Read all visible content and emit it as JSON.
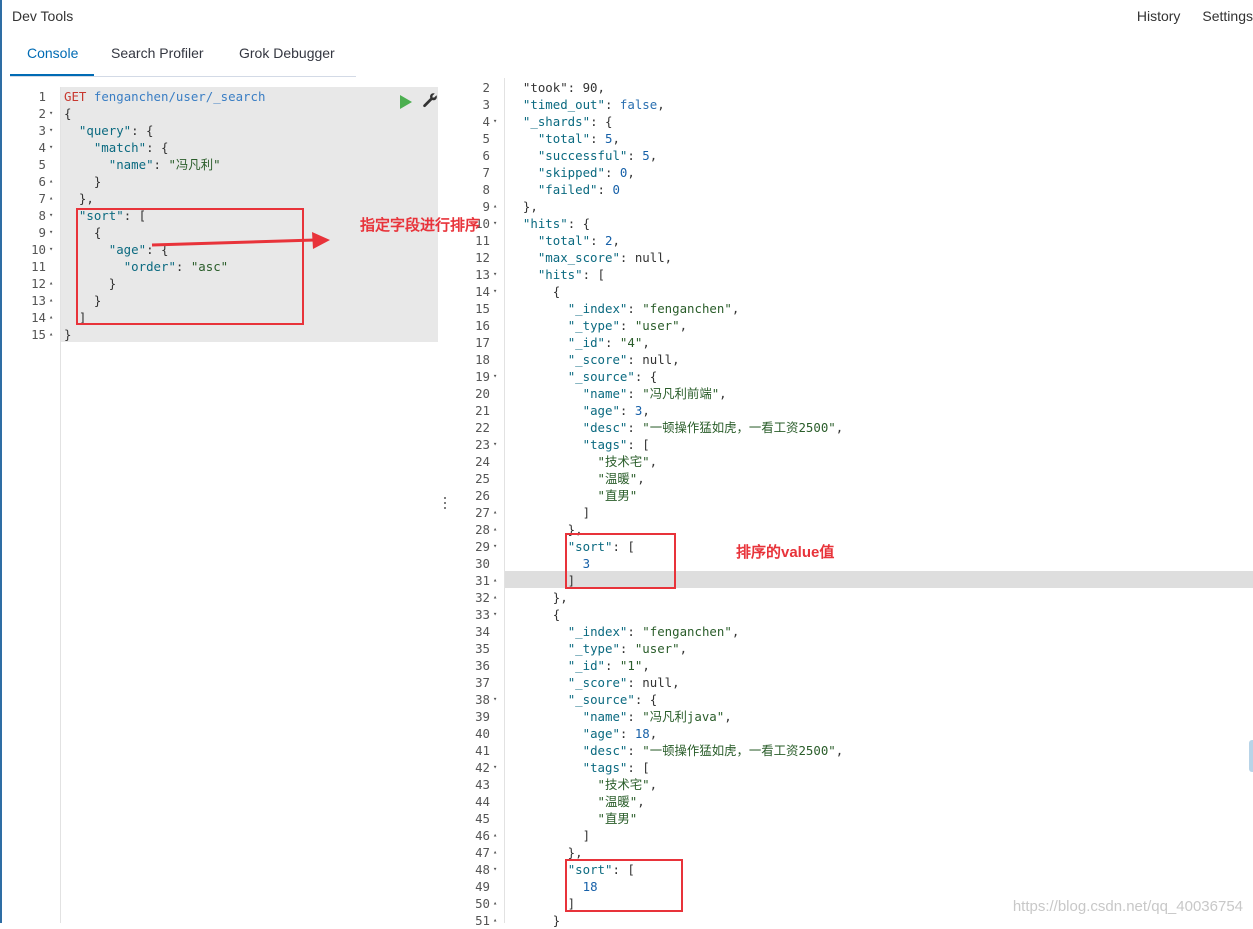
{
  "app": {
    "title": "Dev Tools",
    "history_label": "History",
    "settings_label": "Settings"
  },
  "tabs": [
    {
      "label": "Console",
      "active": true
    },
    {
      "label": "Search Profiler",
      "active": false
    },
    {
      "label": "Grok Debugger",
      "active": false
    }
  ],
  "request_editor": {
    "lines": [
      {
        "n": "1",
        "fold": "",
        "tokens": [
          {
            "t": "GET",
            "c": "get"
          },
          {
            "t": " ",
            "c": ""
          },
          {
            "t": "fenganchen/user/_search",
            "c": "url"
          }
        ]
      },
      {
        "n": "2",
        "fold": "▾",
        "tokens": [
          {
            "t": "{",
            "c": ""
          }
        ]
      },
      {
        "n": "3",
        "fold": "▾",
        "tokens": [
          {
            "t": "  ",
            "c": ""
          },
          {
            "t": "\"query\"",
            "c": "k"
          },
          {
            "t": ": {",
            "c": ""
          }
        ]
      },
      {
        "n": "4",
        "fold": "▾",
        "tokens": [
          {
            "t": "    ",
            "c": ""
          },
          {
            "t": "\"match\"",
            "c": "k"
          },
          {
            "t": ": {",
            "c": ""
          }
        ]
      },
      {
        "n": "5",
        "fold": "",
        "tokens": [
          {
            "t": "      ",
            "c": ""
          },
          {
            "t": "\"name\"",
            "c": "k"
          },
          {
            "t": ": ",
            "c": ""
          },
          {
            "t": "\"冯凡利\"",
            "c": "s"
          }
        ]
      },
      {
        "n": "6",
        "fold": "▴",
        "tokens": [
          {
            "t": "    }",
            "c": ""
          }
        ]
      },
      {
        "n": "7",
        "fold": "▴",
        "tokens": [
          {
            "t": "  },",
            "c": ""
          }
        ]
      },
      {
        "n": "8",
        "fold": "▾",
        "tokens": [
          {
            "t": "  ",
            "c": ""
          },
          {
            "t": "\"sort\"",
            "c": "k"
          },
          {
            "t": ": [",
            "c": ""
          }
        ]
      },
      {
        "n": "9",
        "fold": "▾",
        "tokens": [
          {
            "t": "    {",
            "c": ""
          }
        ]
      },
      {
        "n": "10",
        "fold": "▾",
        "tokens": [
          {
            "t": "      ",
            "c": ""
          },
          {
            "t": "\"age\"",
            "c": "k"
          },
          {
            "t": ": {",
            "c": ""
          }
        ]
      },
      {
        "n": "11",
        "fold": "",
        "tokens": [
          {
            "t": "        ",
            "c": ""
          },
          {
            "t": "\"order\"",
            "c": "k"
          },
          {
            "t": ": ",
            "c": ""
          },
          {
            "t": "\"asc\"",
            "c": "s"
          }
        ]
      },
      {
        "n": "12",
        "fold": "▴",
        "tokens": [
          {
            "t": "      }",
            "c": ""
          }
        ]
      },
      {
        "n": "13",
        "fold": "▴",
        "tokens": [
          {
            "t": "    }",
            "c": ""
          }
        ]
      },
      {
        "n": "14",
        "fold": "▴",
        "tokens": [
          {
            "t": "  ]",
            "c": ""
          }
        ]
      },
      {
        "n": "15",
        "fold": "▴",
        "tokens": [
          {
            "t": "}",
            "c": ""
          }
        ]
      }
    ]
  },
  "response_editor": {
    "highlighted_line": "31",
    "lines": [
      {
        "n": "2",
        "fold": "",
        "tokens": [
          {
            "t": "  \"took\": 90,",
            "c": ""
          }
        ]
      },
      {
        "n": "3",
        "fold": "",
        "tokens": [
          {
            "t": "  ",
            "c": ""
          },
          {
            "t": "\"timed_out\"",
            "c": "k"
          },
          {
            "t": ": ",
            "c": ""
          },
          {
            "t": "false",
            "c": "b"
          },
          {
            "t": ",",
            "c": ""
          }
        ]
      },
      {
        "n": "4",
        "fold": "▾",
        "tokens": [
          {
            "t": "  ",
            "c": ""
          },
          {
            "t": "\"_shards\"",
            "c": "k"
          },
          {
            "t": ": {",
            "c": ""
          }
        ]
      },
      {
        "n": "5",
        "fold": "",
        "tokens": [
          {
            "t": "    ",
            "c": ""
          },
          {
            "t": "\"total\"",
            "c": "k"
          },
          {
            "t": ": ",
            "c": ""
          },
          {
            "t": "5",
            "c": "n"
          },
          {
            "t": ",",
            "c": ""
          }
        ]
      },
      {
        "n": "6",
        "fold": "",
        "tokens": [
          {
            "t": "    ",
            "c": ""
          },
          {
            "t": "\"successful\"",
            "c": "k"
          },
          {
            "t": ": ",
            "c": ""
          },
          {
            "t": "5",
            "c": "n"
          },
          {
            "t": ",",
            "c": ""
          }
        ]
      },
      {
        "n": "7",
        "fold": "",
        "tokens": [
          {
            "t": "    ",
            "c": ""
          },
          {
            "t": "\"skipped\"",
            "c": "k"
          },
          {
            "t": ": ",
            "c": ""
          },
          {
            "t": "0",
            "c": "n"
          },
          {
            "t": ",",
            "c": ""
          }
        ]
      },
      {
        "n": "8",
        "fold": "",
        "tokens": [
          {
            "t": "    ",
            "c": ""
          },
          {
            "t": "\"failed\"",
            "c": "k"
          },
          {
            "t": ": ",
            "c": ""
          },
          {
            "t": "0",
            "c": "n"
          }
        ]
      },
      {
        "n": "9",
        "fold": "▴",
        "tokens": [
          {
            "t": "  },",
            "c": ""
          }
        ]
      },
      {
        "n": "10",
        "fold": "▾",
        "tokens": [
          {
            "t": "  ",
            "c": ""
          },
          {
            "t": "\"hits\"",
            "c": "k"
          },
          {
            "t": ": {",
            "c": ""
          }
        ]
      },
      {
        "n": "11",
        "fold": "",
        "tokens": [
          {
            "t": "    ",
            "c": ""
          },
          {
            "t": "\"total\"",
            "c": "k"
          },
          {
            "t": ": ",
            "c": ""
          },
          {
            "t": "2",
            "c": "n"
          },
          {
            "t": ",",
            "c": ""
          }
        ]
      },
      {
        "n": "12",
        "fold": "",
        "tokens": [
          {
            "t": "    ",
            "c": ""
          },
          {
            "t": "\"max_score\"",
            "c": "k"
          },
          {
            "t": ": null,",
            "c": ""
          }
        ]
      },
      {
        "n": "13",
        "fold": "▾",
        "tokens": [
          {
            "t": "    ",
            "c": ""
          },
          {
            "t": "\"hits\"",
            "c": "k"
          },
          {
            "t": ": [",
            "c": ""
          }
        ]
      },
      {
        "n": "14",
        "fold": "▾",
        "tokens": [
          {
            "t": "      {",
            "c": ""
          }
        ]
      },
      {
        "n": "15",
        "fold": "",
        "tokens": [
          {
            "t": "        ",
            "c": ""
          },
          {
            "t": "\"_index\"",
            "c": "k"
          },
          {
            "t": ": ",
            "c": ""
          },
          {
            "t": "\"fenganchen\"",
            "c": "s"
          },
          {
            "t": ",",
            "c": ""
          }
        ]
      },
      {
        "n": "16",
        "fold": "",
        "tokens": [
          {
            "t": "        ",
            "c": ""
          },
          {
            "t": "\"_type\"",
            "c": "k"
          },
          {
            "t": ": ",
            "c": ""
          },
          {
            "t": "\"user\"",
            "c": "s"
          },
          {
            "t": ",",
            "c": ""
          }
        ]
      },
      {
        "n": "17",
        "fold": "",
        "tokens": [
          {
            "t": "        ",
            "c": ""
          },
          {
            "t": "\"_id\"",
            "c": "k"
          },
          {
            "t": ": ",
            "c": ""
          },
          {
            "t": "\"4\"",
            "c": "s"
          },
          {
            "t": ",",
            "c": ""
          }
        ]
      },
      {
        "n": "18",
        "fold": "",
        "tokens": [
          {
            "t": "        ",
            "c": ""
          },
          {
            "t": "\"_score\"",
            "c": "k"
          },
          {
            "t": ": null,",
            "c": ""
          }
        ]
      },
      {
        "n": "19",
        "fold": "▾",
        "tokens": [
          {
            "t": "        ",
            "c": ""
          },
          {
            "t": "\"_source\"",
            "c": "k"
          },
          {
            "t": ": {",
            "c": ""
          }
        ]
      },
      {
        "n": "20",
        "fold": "",
        "tokens": [
          {
            "t": "          ",
            "c": ""
          },
          {
            "t": "\"name\"",
            "c": "k"
          },
          {
            "t": ": ",
            "c": ""
          },
          {
            "t": "\"冯凡利前端\"",
            "c": "s"
          },
          {
            "t": ",",
            "c": ""
          }
        ]
      },
      {
        "n": "21",
        "fold": "",
        "tokens": [
          {
            "t": "          ",
            "c": ""
          },
          {
            "t": "\"age\"",
            "c": "k"
          },
          {
            "t": ": ",
            "c": ""
          },
          {
            "t": "3",
            "c": "n"
          },
          {
            "t": ",",
            "c": ""
          }
        ]
      },
      {
        "n": "22",
        "fold": "",
        "tokens": [
          {
            "t": "          ",
            "c": ""
          },
          {
            "t": "\"desc\"",
            "c": "k"
          },
          {
            "t": ": ",
            "c": ""
          },
          {
            "t": "\"一顿操作猛如虎，一看工资2500\"",
            "c": "s"
          },
          {
            "t": ",",
            "c": ""
          }
        ]
      },
      {
        "n": "23",
        "fold": "▾",
        "tokens": [
          {
            "t": "          ",
            "c": ""
          },
          {
            "t": "\"tags\"",
            "c": "k"
          },
          {
            "t": ": [",
            "c": ""
          }
        ]
      },
      {
        "n": "24",
        "fold": "",
        "tokens": [
          {
            "t": "            ",
            "c": ""
          },
          {
            "t": "\"技术宅\"",
            "c": "s"
          },
          {
            "t": ",",
            "c": ""
          }
        ]
      },
      {
        "n": "25",
        "fold": "",
        "tokens": [
          {
            "t": "            ",
            "c": ""
          },
          {
            "t": "\"温暖\"",
            "c": "s"
          },
          {
            "t": ",",
            "c": ""
          }
        ]
      },
      {
        "n": "26",
        "fold": "",
        "tokens": [
          {
            "t": "            ",
            "c": ""
          },
          {
            "t": "\"直男\"",
            "c": "s"
          }
        ]
      },
      {
        "n": "27",
        "fold": "▴",
        "tokens": [
          {
            "t": "          ]",
            "c": ""
          }
        ]
      },
      {
        "n": "28",
        "fold": "▴",
        "tokens": [
          {
            "t": "        },",
            "c": ""
          }
        ]
      },
      {
        "n": "29",
        "fold": "▾",
        "tokens": [
          {
            "t": "        ",
            "c": ""
          },
          {
            "t": "\"sort\"",
            "c": "k"
          },
          {
            "t": ": [",
            "c": ""
          }
        ]
      },
      {
        "n": "30",
        "fold": "",
        "tokens": [
          {
            "t": "          ",
            "c": ""
          },
          {
            "t": "3",
            "c": "n"
          }
        ]
      },
      {
        "n": "31",
        "fold": "▴",
        "tokens": [
          {
            "t": "        ]",
            "c": ""
          }
        ]
      },
      {
        "n": "32",
        "fold": "▴",
        "tokens": [
          {
            "t": "      },",
            "c": ""
          }
        ]
      },
      {
        "n": "33",
        "fold": "▾",
        "tokens": [
          {
            "t": "      {",
            "c": ""
          }
        ]
      },
      {
        "n": "34",
        "fold": "",
        "tokens": [
          {
            "t": "        ",
            "c": ""
          },
          {
            "t": "\"_index\"",
            "c": "k"
          },
          {
            "t": ": ",
            "c": ""
          },
          {
            "t": "\"fenganchen\"",
            "c": "s"
          },
          {
            "t": ",",
            "c": ""
          }
        ]
      },
      {
        "n": "35",
        "fold": "",
        "tokens": [
          {
            "t": "        ",
            "c": ""
          },
          {
            "t": "\"_type\"",
            "c": "k"
          },
          {
            "t": ": ",
            "c": ""
          },
          {
            "t": "\"user\"",
            "c": "s"
          },
          {
            "t": ",",
            "c": ""
          }
        ]
      },
      {
        "n": "36",
        "fold": "",
        "tokens": [
          {
            "t": "        ",
            "c": ""
          },
          {
            "t": "\"_id\"",
            "c": "k"
          },
          {
            "t": ": ",
            "c": ""
          },
          {
            "t": "\"1\"",
            "c": "s"
          },
          {
            "t": ",",
            "c": ""
          }
        ]
      },
      {
        "n": "37",
        "fold": "",
        "tokens": [
          {
            "t": "        ",
            "c": ""
          },
          {
            "t": "\"_score\"",
            "c": "k"
          },
          {
            "t": ": null,",
            "c": ""
          }
        ]
      },
      {
        "n": "38",
        "fold": "▾",
        "tokens": [
          {
            "t": "        ",
            "c": ""
          },
          {
            "t": "\"_source\"",
            "c": "k"
          },
          {
            "t": ": {",
            "c": ""
          }
        ]
      },
      {
        "n": "39",
        "fold": "",
        "tokens": [
          {
            "t": "          ",
            "c": ""
          },
          {
            "t": "\"name\"",
            "c": "k"
          },
          {
            "t": ": ",
            "c": ""
          },
          {
            "t": "\"冯凡利java\"",
            "c": "s"
          },
          {
            "t": ",",
            "c": ""
          }
        ]
      },
      {
        "n": "40",
        "fold": "",
        "tokens": [
          {
            "t": "          ",
            "c": ""
          },
          {
            "t": "\"age\"",
            "c": "k"
          },
          {
            "t": ": ",
            "c": ""
          },
          {
            "t": "18",
            "c": "n"
          },
          {
            "t": ",",
            "c": ""
          }
        ]
      },
      {
        "n": "41",
        "fold": "",
        "tokens": [
          {
            "t": "          ",
            "c": ""
          },
          {
            "t": "\"desc\"",
            "c": "k"
          },
          {
            "t": ": ",
            "c": ""
          },
          {
            "t": "\"一顿操作猛如虎，一看工资2500\"",
            "c": "s"
          },
          {
            "t": ",",
            "c": ""
          }
        ]
      },
      {
        "n": "42",
        "fold": "▾",
        "tokens": [
          {
            "t": "          ",
            "c": ""
          },
          {
            "t": "\"tags\"",
            "c": "k"
          },
          {
            "t": ": [",
            "c": ""
          }
        ]
      },
      {
        "n": "43",
        "fold": "",
        "tokens": [
          {
            "t": "            ",
            "c": ""
          },
          {
            "t": "\"技术宅\"",
            "c": "s"
          },
          {
            "t": ",",
            "c": ""
          }
        ]
      },
      {
        "n": "44",
        "fold": "",
        "tokens": [
          {
            "t": "            ",
            "c": ""
          },
          {
            "t": "\"温暖\"",
            "c": "s"
          },
          {
            "t": ",",
            "c": ""
          }
        ]
      },
      {
        "n": "45",
        "fold": "",
        "tokens": [
          {
            "t": "            ",
            "c": ""
          },
          {
            "t": "\"直男\"",
            "c": "s"
          }
        ]
      },
      {
        "n": "46",
        "fold": "▴",
        "tokens": [
          {
            "t": "          ]",
            "c": ""
          }
        ]
      },
      {
        "n": "47",
        "fold": "▴",
        "tokens": [
          {
            "t": "        },",
            "c": ""
          }
        ]
      },
      {
        "n": "48",
        "fold": "▾",
        "tokens": [
          {
            "t": "        ",
            "c": ""
          },
          {
            "t": "\"sort\"",
            "c": "k"
          },
          {
            "t": ": [",
            "c": ""
          }
        ]
      },
      {
        "n": "49",
        "fold": "",
        "tokens": [
          {
            "t": "          ",
            "c": ""
          },
          {
            "t": "18",
            "c": "n"
          }
        ]
      },
      {
        "n": "50",
        "fold": "▴",
        "tokens": [
          {
            "t": "        ]",
            "c": ""
          }
        ]
      },
      {
        "n": "51",
        "fold": "▴",
        "tokens": [
          {
            "t": "      }",
            "c": ""
          }
        ]
      }
    ]
  },
  "annotations": {
    "sort_note": "指定字段进行排序",
    "value_note": "排序的value值",
    "color": "#e8333a"
  },
  "watermark": "https://blog.csdn.net/qq_40036754",
  "icons": {
    "run": "play-icon",
    "settings": "wrench-icon"
  },
  "colors": {
    "accent": "#006bb4",
    "run_green": "#4caf50",
    "request_bg": "#e8e8e8"
  }
}
